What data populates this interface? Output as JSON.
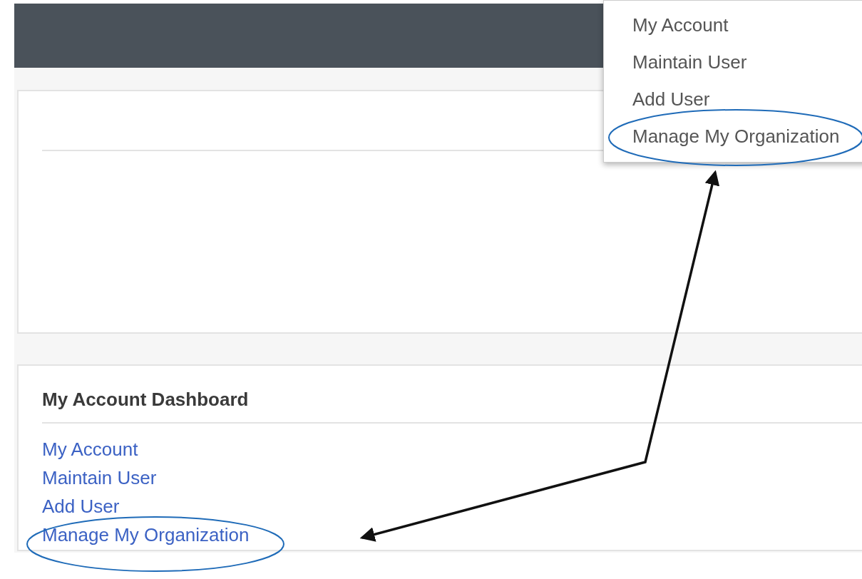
{
  "dropdown_menu": {
    "items": [
      {
        "label": "My Account"
      },
      {
        "label": "Maintain User"
      },
      {
        "label": "Add User"
      },
      {
        "label": "Manage My Organization"
      }
    ]
  },
  "dashboard": {
    "title": "My Account Dashboard",
    "links": [
      {
        "label": "My Account"
      },
      {
        "label": "Maintain User"
      },
      {
        "label": "Add User"
      },
      {
        "label": "Manage My Organization"
      }
    ]
  }
}
